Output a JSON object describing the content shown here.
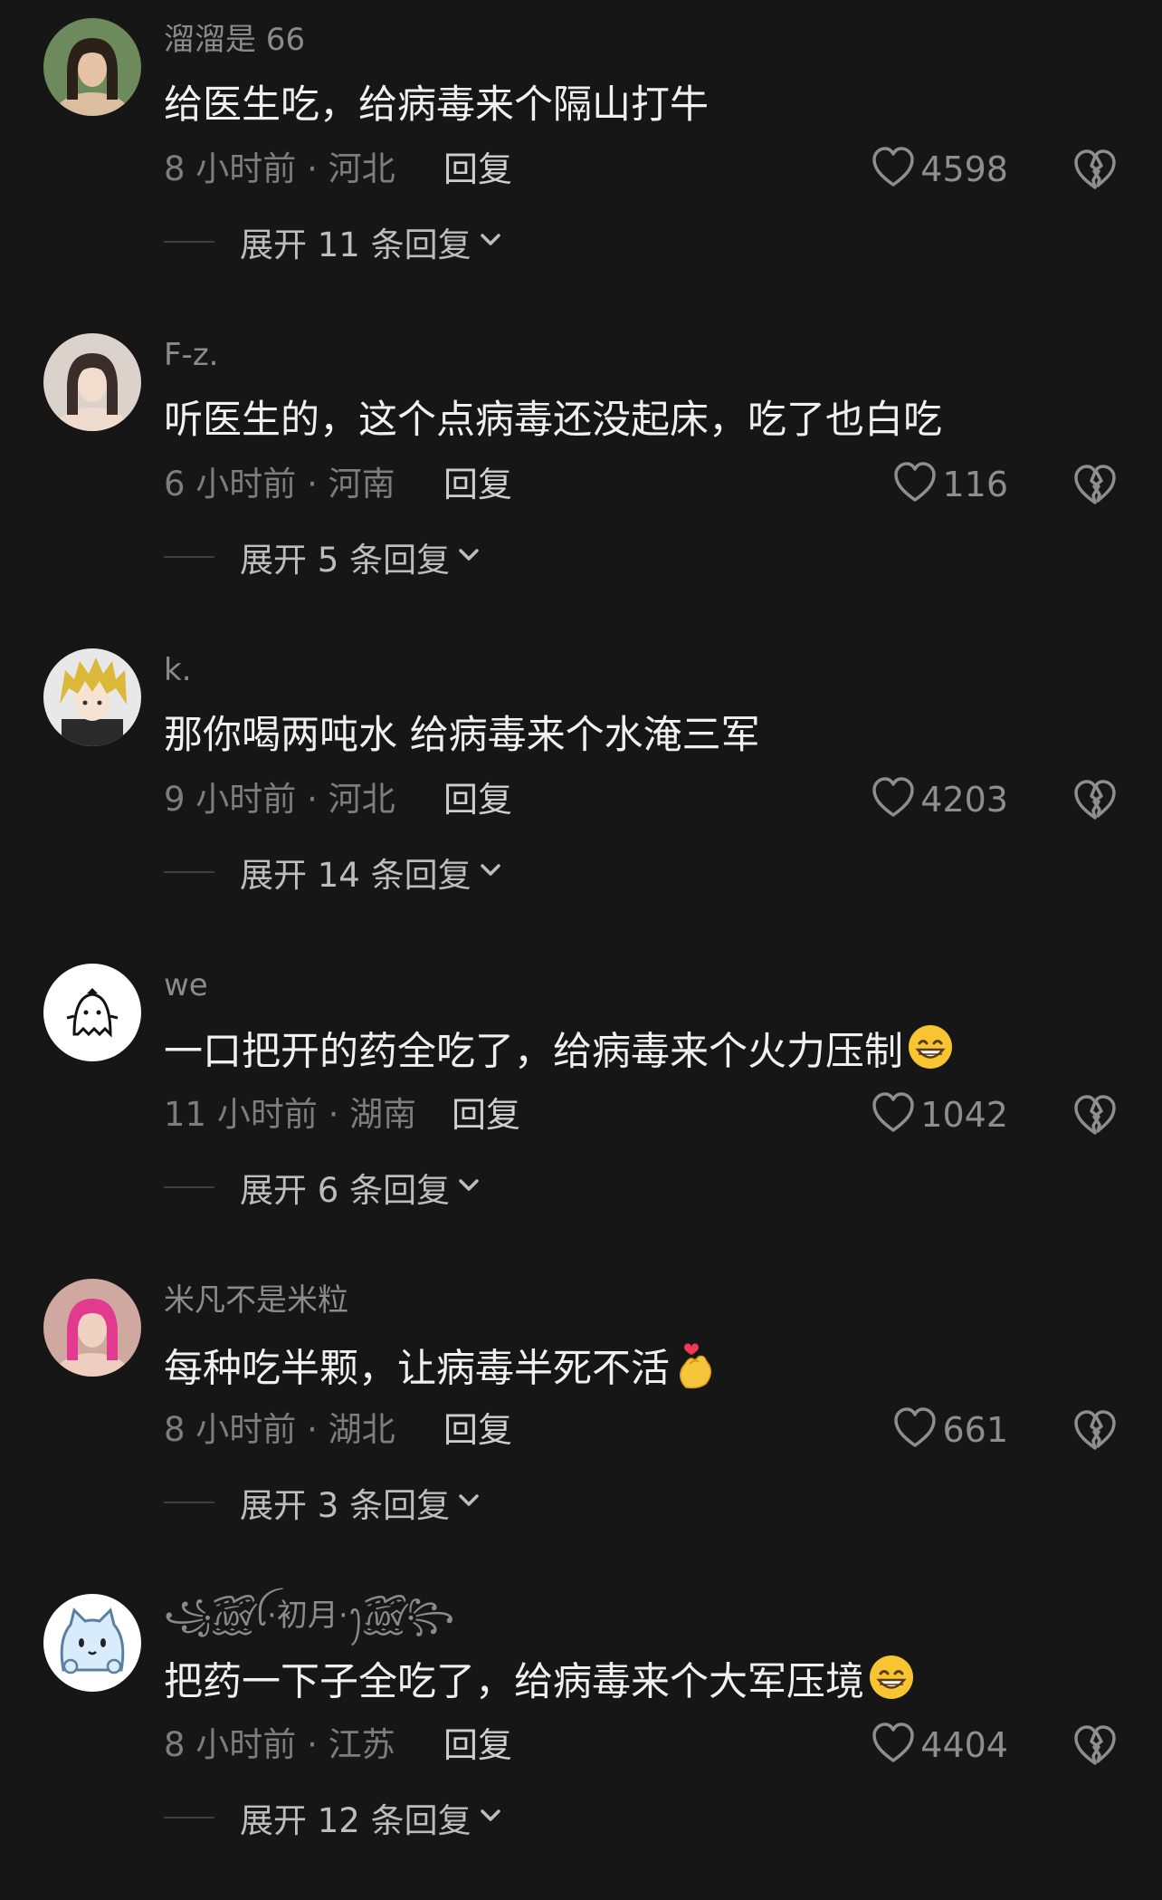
{
  "comments": [
    {
      "username": "溜溜是 66",
      "text": "给医生吃，给病毒来个隔山打牛",
      "emoji": "",
      "time_location": "8 小时前 · 河北",
      "reply_label": "回复",
      "likes": "4598",
      "expand_label": "展开 11 条回复",
      "avatar_icon": "portrait-icon",
      "colors": {
        "bg": "#6d8a5c",
        "face": "#e6c3a6",
        "hair": "#2b2119"
      }
    },
    {
      "username": "F-z.",
      "text": "听医生的，这个点病毒还没起床，吃了也白吃",
      "emoji": "",
      "time_location": "6 小时前 · 河南",
      "reply_label": "回复",
      "likes": "116",
      "expand_label": "展开 5 条回复",
      "avatar_icon": "portrait-icon",
      "colors": {
        "bg": "#dcd2cc",
        "face": "#f1dccd",
        "hair": "#3a2d2a"
      }
    },
    {
      "username": "k.",
      "text": "那你喝两吨水 给病毒来个水淹三军",
      "emoji": "",
      "time_location": "9 小时前 · 河北",
      "reply_label": "回复",
      "likes": "4203",
      "expand_label": "展开 14 条回复",
      "avatar_icon": "anime-character-icon",
      "colors": {
        "bg": "#e8e8e8",
        "face": "#f5e4d2",
        "hair": "#d9b83a"
      }
    },
    {
      "username": "we",
      "text": "一口把开的药全吃了，给病毒来个火力压制",
      "emoji": "grin",
      "time_location": "11 小时前 · 湖南",
      "reply_label": "回复",
      "likes": "1042",
      "expand_label": "展开 6 条回复",
      "avatar_icon": "ghost-icon",
      "colors": {
        "bg": "#ffffff",
        "face": "#ffffff",
        "hair": "#111111"
      }
    },
    {
      "username": "米凡不是米粒",
      "text": "每种吃半颗，让病毒半死不活",
      "emoji": "finger-heart",
      "time_location": "8 小时前 · 湖北",
      "reply_label": "回复",
      "likes": "661",
      "expand_label": "展开 3 条回复",
      "avatar_icon": "portrait-icon",
      "colors": {
        "bg": "#cfa8a0",
        "face": "#f0d2c2",
        "hair": "#e23a8e"
      }
    },
    {
      "username": "꧁꫞ꪶ·初月·ꫂ꫞꧂",
      "text": "把药一下子全吃了，给病毒来个大军压境",
      "emoji": "grin",
      "time_location": "8 小时前 · 江苏",
      "reply_label": "回复",
      "likes": "4404",
      "expand_label": "展开 12 条回复",
      "avatar_icon": "cat-icon",
      "colors": {
        "bg": "#ffffff",
        "face": "#d9ecfb",
        "hair": "#5a7fa3"
      }
    }
  ]
}
